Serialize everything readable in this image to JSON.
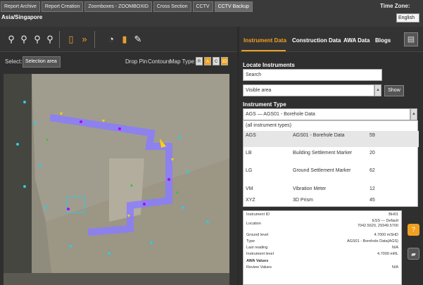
{
  "top_tabs": [
    "Report Archive",
    "Report Creation",
    "Zoomboxes - ZOOMBOXID",
    "Cross Section",
    "CCTV",
    "CCTV Backup"
  ],
  "timezone": {
    "label": "Time Zone:",
    "value": "English"
  },
  "location": "Asia/Singapore",
  "select_row": {
    "label": "Select:",
    "button": "Selection area",
    "drop_pin": "Drop Pin",
    "contours": "Contours",
    "map_type": "Map Type:",
    "map_types": [
      "R",
      "A",
      "C",
      "3D"
    ]
  },
  "right_tabs": [
    "Instrument Data",
    "Construction Data",
    "AWA Data",
    "Blogs"
  ],
  "locate": {
    "title": "Locate Instruments",
    "search_placeholder": "Search",
    "area_value": "Visible area",
    "show_button": "Show"
  },
  "instrument_type": {
    "title": "Instrument Type",
    "current": "AGS — AGS01 - Borehole Data"
  },
  "dropdown": [
    {
      "code": "(all instrument types)",
      "name": "",
      "count": ""
    },
    {
      "code": "AGS",
      "name": "AGS01 - Borehole Data",
      "count": "59"
    },
    {
      "code": "LB",
      "name": "Building Settlement Marker",
      "count": "20"
    },
    {
      "code": "LG",
      "name": "Ground Settlement Marker",
      "count": "62"
    },
    {
      "code": "VM",
      "name": "Vibration Meter",
      "count": "12"
    },
    {
      "code": "XYZ",
      "name": "3D Prism",
      "count": "45"
    }
  ],
  "details": [
    {
      "label": "Instrument ID",
      "value": "BH01"
    },
    {
      "label": "Location",
      "value": "ESS — Default\n7042.5620, 29349.5700"
    },
    {
      "label": "Ground level",
      "value": "4.7000 mSHD"
    },
    {
      "label": "Type",
      "value": "AGS01 - Borehole Data(AGS)"
    },
    {
      "label": "Last reading",
      "value": "N/A"
    },
    {
      "label": "Instrument level",
      "value": "4.7000 mRL"
    },
    {
      "label": "AWA Values",
      "value": ""
    },
    {
      "label": "Review Values",
      "value": "N/A"
    }
  ],
  "icons": {
    "tools": [
      "zoom-in-icon",
      "zoom-out-icon",
      "zoom-extent-icon",
      "zoom-previous-icon",
      "layers-icon",
      "double-chevron-icon",
      "bulb-icon",
      "pin-icon",
      "pencil-icon"
    ],
    "right": [
      "report-icon",
      "help-icon",
      "folder-icon"
    ]
  },
  "colors": {
    "accent": "#f0a020",
    "alignment": "#8a7cff",
    "marker_cyan": "#35c8d8",
    "marker_yellow": "#ffd400"
  }
}
